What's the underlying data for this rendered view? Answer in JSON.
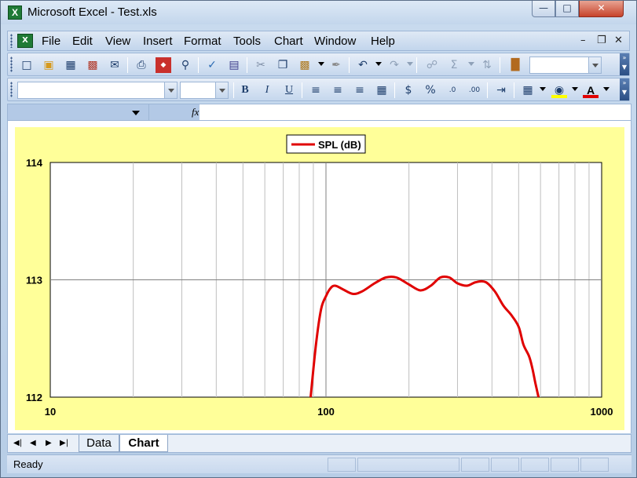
{
  "window": {
    "title": "Microsoft Excel - Test.xls",
    "app_icon": "X"
  },
  "menu": {
    "items": [
      "File",
      "Edit",
      "View",
      "Insert",
      "Format",
      "Tools",
      "Chart",
      "Window",
      "Help"
    ]
  },
  "formula_bar": {
    "fx_label": "fx"
  },
  "sheet_tabs": [
    "Data",
    "Chart"
  ],
  "active_tab": "Chart",
  "status": {
    "text": "Ready"
  },
  "chart_data": {
    "type": "line",
    "x_scale": "log",
    "xlim": [
      10,
      1000
    ],
    "ylim": [
      112,
      114
    ],
    "x_ticks": [
      "10",
      "100",
      "1000"
    ],
    "y_ticks": [
      "112",
      "113",
      "114"
    ],
    "grid": true,
    "legend_position": "top-center",
    "series": [
      {
        "name": "SPL (dB)",
        "color": "#e00000",
        "x": [
          88,
          92,
          96,
          100,
          104,
          108,
          115,
          125,
          135,
          150,
          165,
          180,
          200,
          220,
          240,
          260,
          280,
          300,
          325,
          350,
          380,
          410,
          440,
          470,
          500,
          520,
          545,
          560,
          575,
          590
        ],
        "y": [
          112.0,
          112.45,
          112.75,
          112.86,
          112.93,
          112.95,
          112.92,
          112.88,
          112.9,
          112.97,
          113.02,
          113.02,
          112.96,
          112.91,
          112.95,
          113.02,
          113.02,
          112.97,
          112.95,
          112.98,
          112.98,
          112.9,
          112.78,
          112.7,
          112.6,
          112.45,
          112.35,
          112.25,
          112.12,
          112.0
        ]
      }
    ]
  },
  "colors": {
    "chart_background": "#ffff99",
    "plot_background": "#ffffff",
    "series_line": "#e00000",
    "gridline": "#bfbfbf"
  },
  "icons": {
    "standard_toolbar": [
      "new-icon",
      "open-icon",
      "save-icon",
      "permission-icon",
      "email-icon",
      "print-icon",
      "research-icon",
      "print-preview-icon",
      "spelling-icon",
      "research-book-icon",
      "cut-icon",
      "copy-icon",
      "paste-icon",
      "format-painter-icon",
      "undo-icon",
      "redo-icon",
      "hyperlink-icon",
      "autosum-icon",
      "sort-icon",
      "chart-wizard-icon"
    ],
    "formatting_toolbar": [
      "bold-icon",
      "italic-icon",
      "underline-icon",
      "align-left-icon",
      "align-center-icon",
      "align-right-icon",
      "merge-center-icon",
      "currency-icon",
      "percent-icon",
      "increase-decimal-icon",
      "decrease-decimal-icon",
      "indent-icon",
      "borders-icon",
      "fill-color-icon",
      "font-color-icon"
    ]
  }
}
